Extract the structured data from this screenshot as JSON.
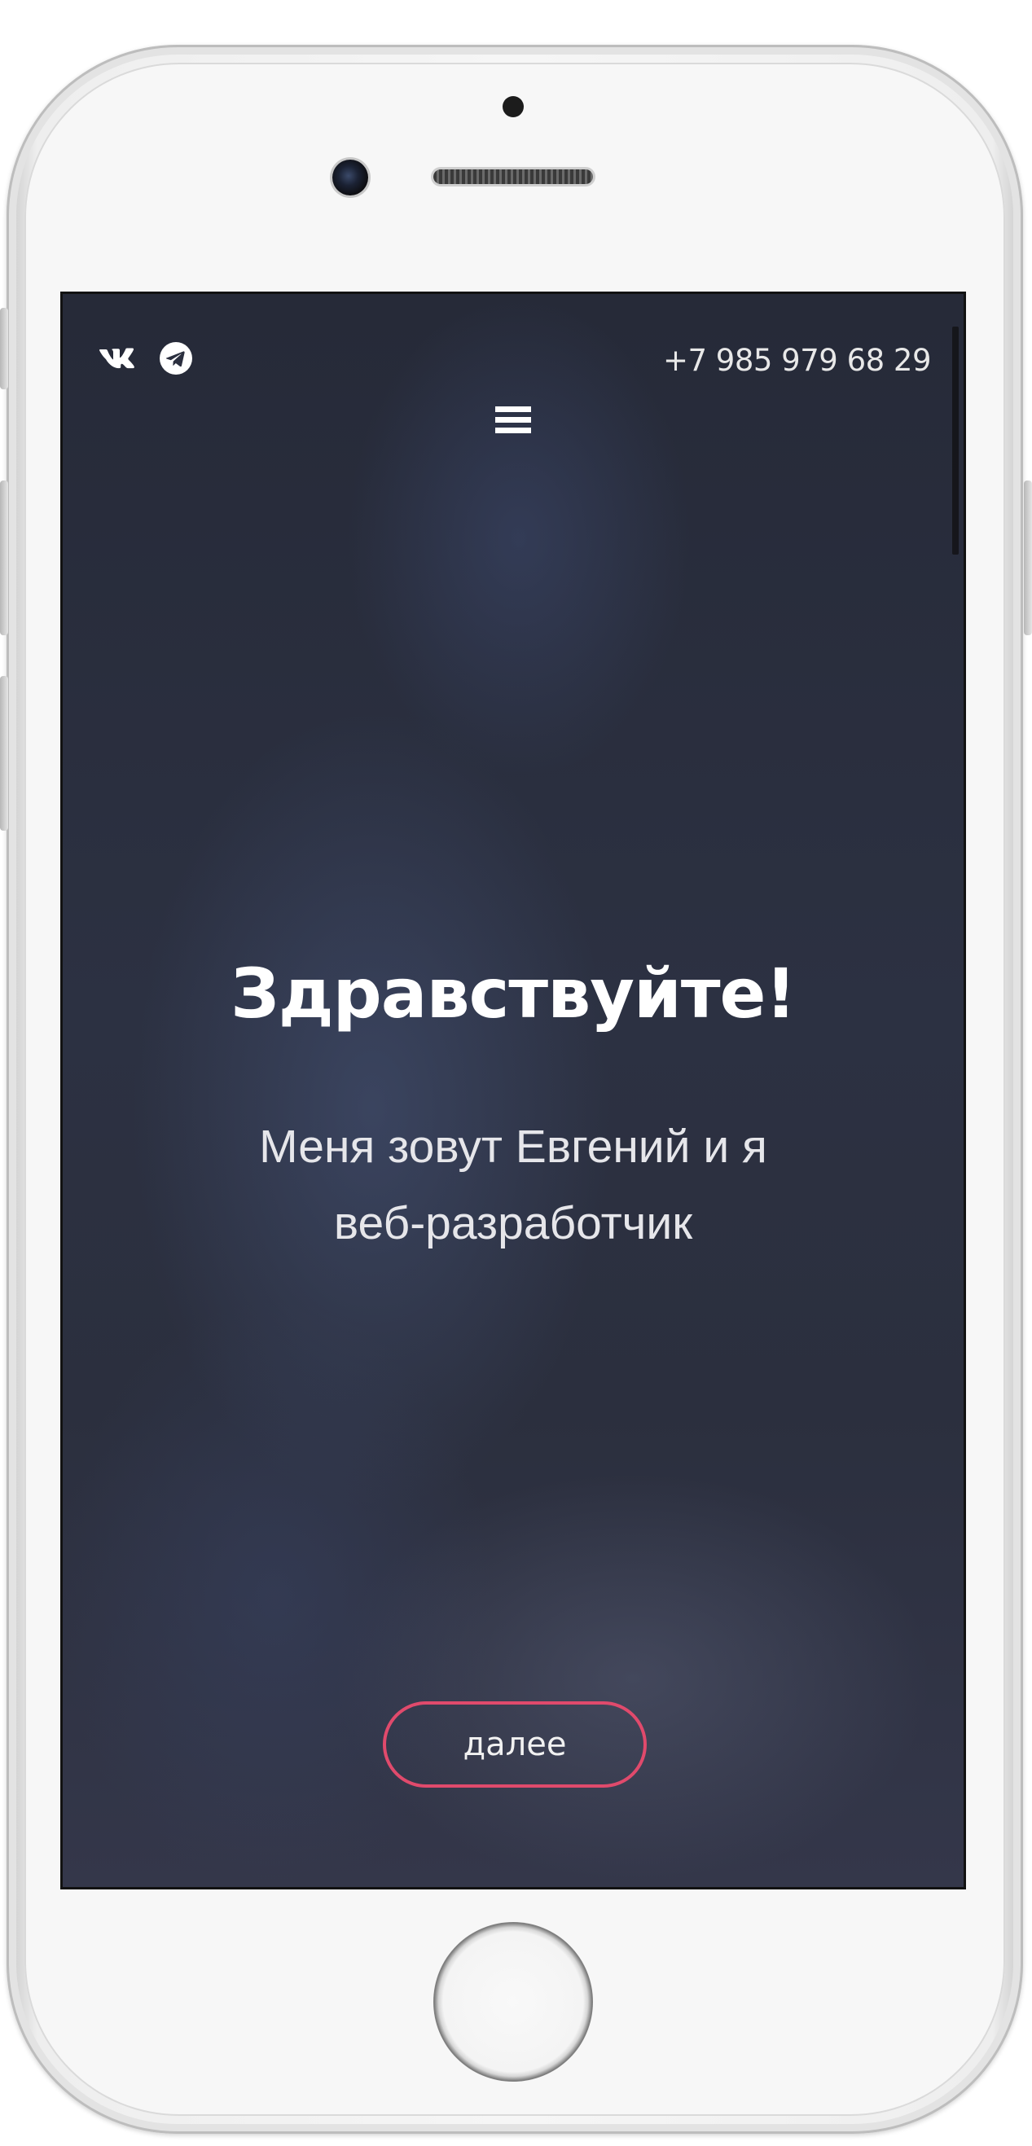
{
  "social": {
    "vk_icon": "vk-icon",
    "telegram_icon": "telegram-icon"
  },
  "header": {
    "phone": "+7 985 979 68 29",
    "menu_icon": "hamburger-menu-icon"
  },
  "hero": {
    "title": "Здравствуйте!",
    "subtitle": "Меня зовут Евгений и я веб-разработчик",
    "button_label": "далее",
    "button_border_color": "#e04a6c"
  },
  "colors": {
    "screen_background": "#2b2f3f",
    "text": "#ffffff"
  }
}
